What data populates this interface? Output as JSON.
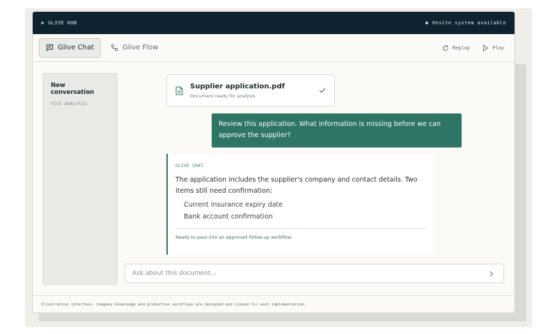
{
  "topbar": {
    "brand": "GLIVE HUB",
    "status": "Onsite system available",
    "brand_dot_color": "#5ec3a8",
    "status_dot_color": "#cfd8dc"
  },
  "toolbar": {
    "tabs": [
      {
        "label": "Glive Chat",
        "icon": "chat-icon",
        "active": true
      },
      {
        "label": "Glive Flow",
        "icon": "flow-icon",
        "active": false
      }
    ],
    "replay_label": "Replay",
    "play_label": "Play"
  },
  "sidebar": {
    "conversation_title": "New conversation",
    "conversation_subtitle": "FILE ANALYSIS"
  },
  "file_card": {
    "name": "Supplier application.pdf",
    "status": "Document ready for analysis"
  },
  "user_message": "Review this application. What information is missing before we can approve the supplier?",
  "assistant": {
    "label": "GLIVE CHAT",
    "body": "The application includes the supplier's company and contact details. Two items still need confirmation:",
    "items": [
      "Current insurance expiry date",
      "Bank account confirmation"
    ],
    "footer": "Ready to pass into an approved follow-up workflow."
  },
  "input": {
    "placeholder": "Ask about this document...",
    "value": ""
  },
  "footer_text": "Illustrative interface. Company knowledge and production workflows are designed and scoped for each implementation.",
  "colors": {
    "accent": "#2f7565",
    "topbar_bg": "#0f2230"
  }
}
